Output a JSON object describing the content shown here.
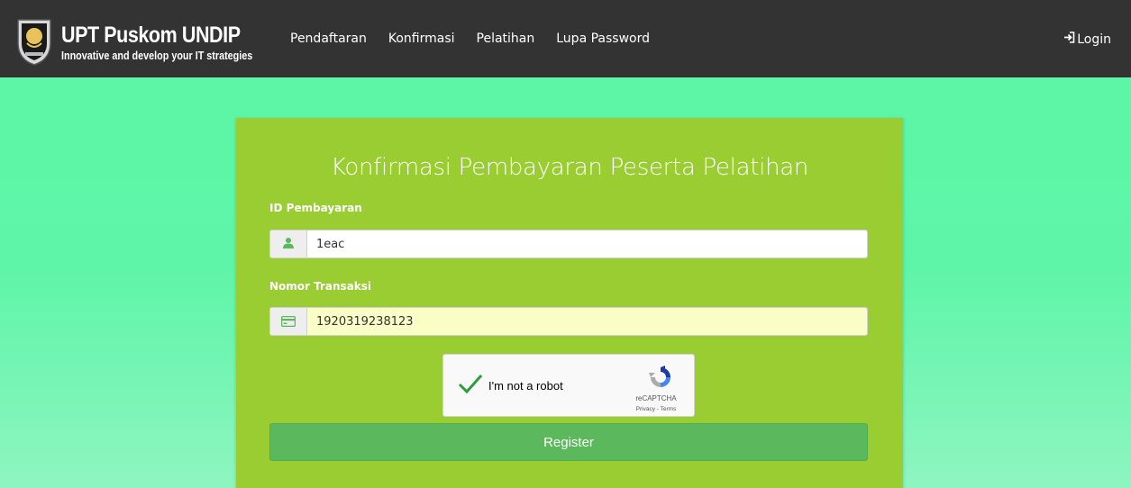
{
  "brand": {
    "title": "UPT Puskom UNDIP",
    "tagline": "Innovative and develop your IT strategies"
  },
  "nav": {
    "items": [
      {
        "label": "Pendaftaran"
      },
      {
        "label": "Konfirmasi"
      },
      {
        "label": "Pelatihan"
      },
      {
        "label": "Lupa Password"
      }
    ],
    "login_label": "Login"
  },
  "form": {
    "title": "Konfirmasi Pembayaran Peserta Pelatihan",
    "id_label": "ID Pembayaran",
    "id_value": "1eac",
    "trx_label": "Nomor Transaksi",
    "trx_value": "1920319238123",
    "recaptcha": {
      "label": "I'm not a robot",
      "brand": "reCAPTCHA",
      "terms": "Privacy - Terms"
    },
    "submit_label": "Register"
  },
  "colors": {
    "navbar": "#333333",
    "card": "#9acd32",
    "button": "#5cb85c",
    "background": "#5ef5a8"
  }
}
